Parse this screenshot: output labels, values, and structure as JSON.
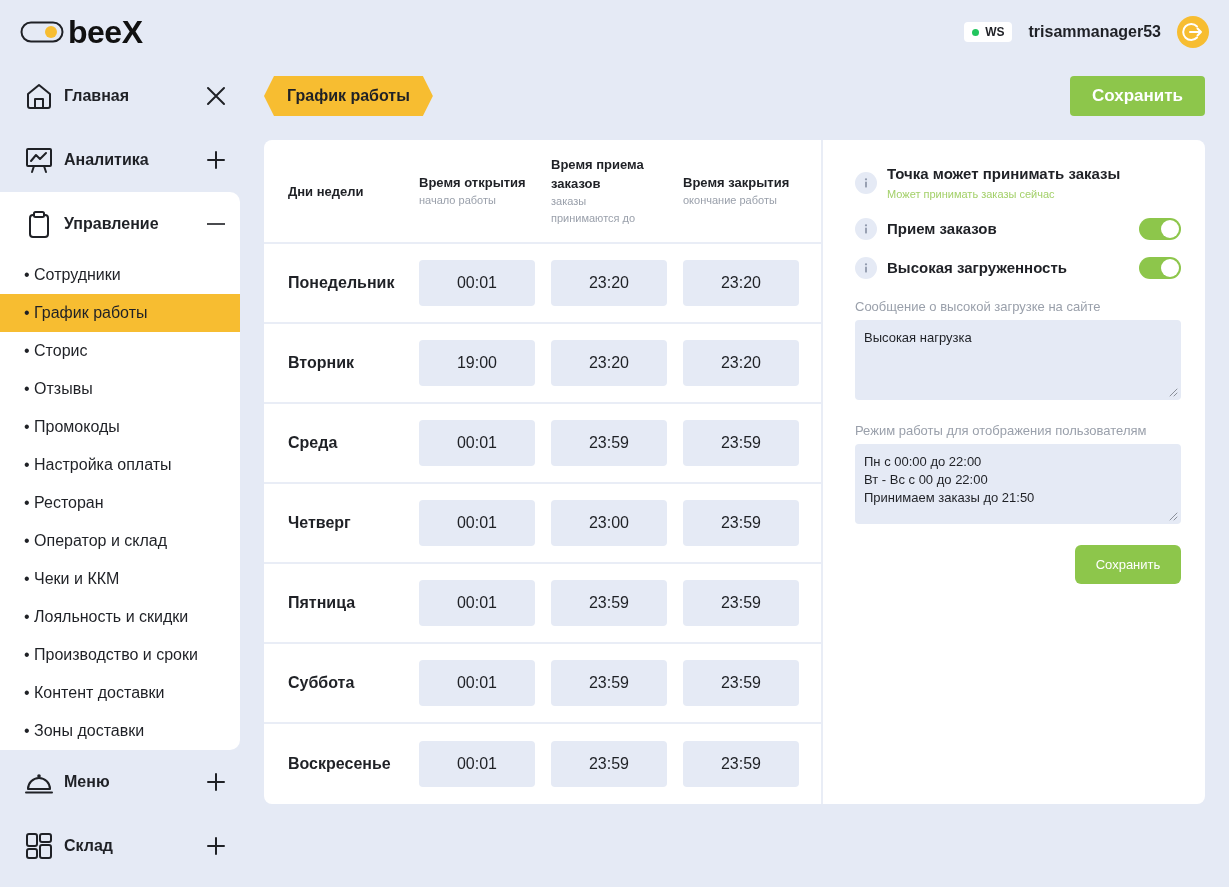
{
  "logo": {
    "text": "beeX"
  },
  "header": {
    "connection": {
      "label": "WS",
      "color": "#22c55e"
    },
    "username": "trisammanager53"
  },
  "sidebar": {
    "items": [
      {
        "label": "Главная",
        "kind": "link"
      },
      {
        "label": "Аналитика",
        "kind": "section",
        "expanded": false
      },
      {
        "label": "Управление",
        "kind": "section",
        "expanded": true,
        "children": [
          {
            "label": "• Сотрудники",
            "selected": false
          },
          {
            "label": "• График работы",
            "selected": true
          },
          {
            "label": "• Сторис",
            "selected": false
          },
          {
            "label": "• Отзывы",
            "selected": false
          },
          {
            "label": "• Промокоды",
            "selected": false
          },
          {
            "label": "• Настройка оплаты",
            "selected": false
          },
          {
            "label": "• Ресторан",
            "selected": false
          },
          {
            "label": "• Оператор и склад",
            "selected": false
          },
          {
            "label": "• Чеки и ККМ",
            "selected": false
          },
          {
            "label": "• Лояльность и скидки",
            "selected": false
          },
          {
            "label": "• Производство и сроки",
            "selected": false
          },
          {
            "label": "• Контент доставки",
            "selected": false
          },
          {
            "label": "• Зоны доставки",
            "selected": false
          }
        ]
      },
      {
        "label": "Меню",
        "kind": "section",
        "expanded": false
      },
      {
        "label": "Склад",
        "kind": "section",
        "expanded": false
      }
    ]
  },
  "page": {
    "title": "График работы",
    "save_button": "Сохранить"
  },
  "schedule": {
    "columns": [
      {
        "title": "Дни недели"
      },
      {
        "title": "Время открытия",
        "subtitle": "начало работы"
      },
      {
        "title": "Время приема заказов",
        "subtitle": "заказы принимаются до"
      },
      {
        "title": "Время закрытия",
        "subtitle": "окончание работы"
      }
    ],
    "rows": [
      {
        "day": "Понедельник",
        "times": [
          "00:01",
          "23:20",
          "23:20"
        ]
      },
      {
        "day": "Вторник",
        "times": [
          "19:00",
          "23:20",
          "23:20"
        ]
      },
      {
        "day": "Среда",
        "times": [
          "00:01",
          "23:59",
          "23:59"
        ]
      },
      {
        "day": "Четверг",
        "times": [
          "00:01",
          "23:00",
          "23:59"
        ]
      },
      {
        "day": "Пятница",
        "times": [
          "00:01",
          "23:59",
          "23:59"
        ]
      },
      {
        "day": "Суббота",
        "times": [
          "00:01",
          "23:59",
          "23:59"
        ]
      },
      {
        "day": "Воскресенье",
        "times": [
          "00:01",
          "23:59",
          "23:59"
        ]
      }
    ]
  },
  "settings": {
    "status": {
      "title": "Точка может принимать заказы",
      "note": "Может принимать заказы сейчас"
    },
    "toggles": [
      {
        "label": "Прием заказов",
        "on": true
      },
      {
        "label": "Высокая загруженность",
        "on": true
      }
    ],
    "fields": [
      {
        "label": "Сообщение о высокой загрузке на сайте",
        "value": "Высокая нагрузка"
      },
      {
        "label": "Режим работы для отображения пользователям",
        "value": "Пн с 00:00 до 22:00\nВт - Вс с 00 до 22:00\nПринимаем заказы до 21:50"
      }
    ],
    "save_button": "Сохранить"
  }
}
